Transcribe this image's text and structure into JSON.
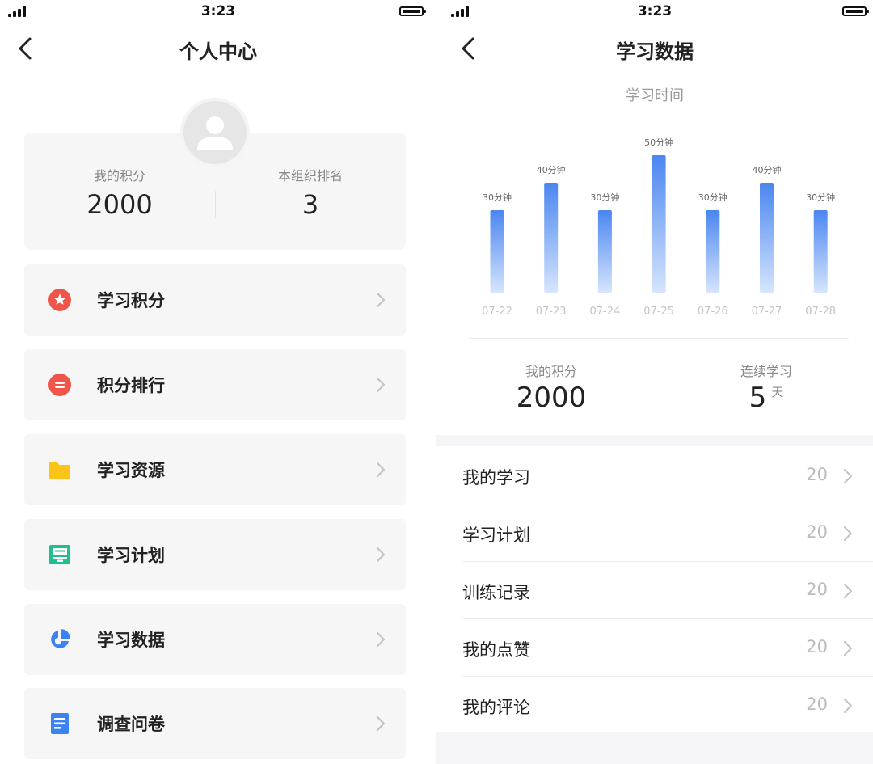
{
  "status_bar": {
    "time": "3:23"
  },
  "left_screen": {
    "title": "个人中心",
    "stats": {
      "points_label": "我的积分",
      "points_value": "2000",
      "rank_label": "本组织排名",
      "rank_value": "3"
    },
    "menu": [
      {
        "label": "学习积分",
        "icon": "star-badge-icon",
        "color": "#f0554a"
      },
      {
        "label": "积分排行",
        "icon": "ranking-list-icon",
        "color": "#f0554a"
      },
      {
        "label": "学习资源",
        "icon": "folder-icon",
        "color": "#fcc419"
      },
      {
        "label": "学习计划",
        "icon": "plan-tray-icon",
        "color": "#1fbf8f"
      },
      {
        "label": "学习数据",
        "icon": "pie-chart-icon",
        "color": "#3b82f6"
      },
      {
        "label": "调查问卷",
        "icon": "document-icon",
        "color": "#3b82f6"
      }
    ]
  },
  "right_screen": {
    "title": "学习数据",
    "chart_subtitle": "学习时间",
    "chart_data": {
      "type": "bar",
      "categories": [
        "07-22",
        "07-23",
        "07-24",
        "07-25",
        "07-26",
        "07-27",
        "07-28"
      ],
      "values": [
        30,
        40,
        30,
        50,
        30,
        40,
        30
      ],
      "value_labels": [
        "30分钟",
        "40分钟",
        "30分钟",
        "50分钟",
        "30分钟",
        "40分钟",
        "30分钟"
      ],
      "ylim": [
        0,
        50
      ],
      "grid": false,
      "bar_color_top": "#4a86f0",
      "bar_color_bottom": "#d6e5fd"
    },
    "stats": {
      "points_label": "我的积分",
      "points_value": "2000",
      "streak_label": "连续学习",
      "streak_value": "5",
      "streak_unit": "天"
    },
    "list": [
      {
        "label": "我的学习",
        "count": "20"
      },
      {
        "label": "学习计划",
        "count": "20"
      },
      {
        "label": "训练记录",
        "count": "20"
      },
      {
        "label": "我的点赞",
        "count": "20"
      },
      {
        "label": "我的评论",
        "count": "20"
      }
    ]
  }
}
